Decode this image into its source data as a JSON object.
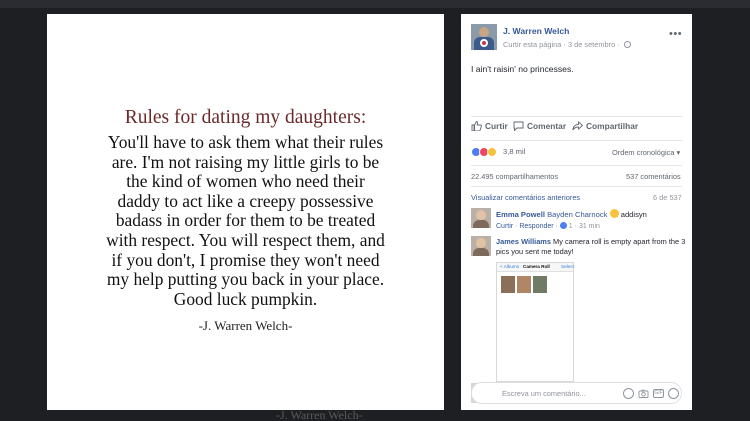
{
  "photo": {
    "title": "Rules for dating my daughters:",
    "body_lines": [
      "You'll have to ask them what their rules",
      "are. I'm not raising my little girls to be",
      "the kind of women who need their",
      "daddy to act like a creepy possessive",
      "badass in order for them to be treated",
      "with respect. You will respect them, and",
      "if you don't, I promise they won't need",
      "my help putting you back in your place.",
      "Good luck pumpkin."
    ],
    "signature": "-J. Warren Welch-"
  },
  "backdrop": {
    "ghost_signature": "-J. Warren Welch-"
  },
  "post": {
    "author": "J. Warren Welch",
    "like_page": "Curtir esta página",
    "separator": "·",
    "date": "3 de setembro",
    "more": "•••",
    "text": "I ain't raisin' no princesses.",
    "actions": {
      "like": "Curtir",
      "comment": "Comentar",
      "share": "Compartilhar"
    },
    "reactions_count": "3,8 mil",
    "order_label": "Ordem cronológica ▾",
    "shares": "22.495 compartilhamentos",
    "comments_count": "537 comentários",
    "previous_comments": "Visualizar comentários anteriores",
    "previous_range": "6 de 537"
  },
  "comments": [
    {
      "name": "Emma Powell",
      "tag": "Bayden Charnock",
      "text": "addisyn",
      "reply_like": "Curtir",
      "reply": "Responder",
      "like_count": "1",
      "time": "31 min"
    },
    {
      "name": "James Williams",
      "text": "My camera roll is empty apart from the 3 pics you sent me today!",
      "phone": {
        "back": "< Albums",
        "title": "Camera Roll",
        "select": "Select"
      }
    }
  ],
  "composer": {
    "placeholder": "Escreva um comentário..."
  },
  "icons": [
    "more-icon",
    "globe-icon",
    "like-icon",
    "comment-icon",
    "share-icon",
    "emoji-icon",
    "camera-icon",
    "gif-icon",
    "sticker-icon"
  ],
  "colors": {
    "link": "#365899",
    "title_maroon": "#6b2a2a",
    "backdrop": "#1d1f23"
  }
}
